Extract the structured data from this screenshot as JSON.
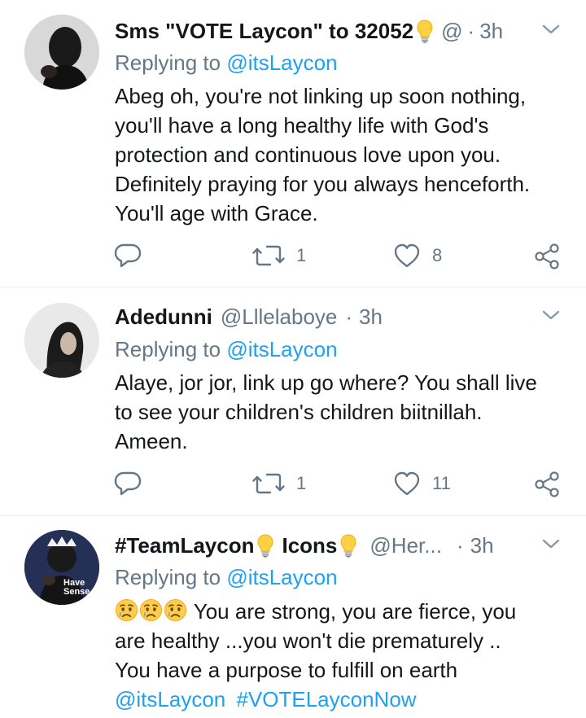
{
  "tweets": [
    {
      "name": "Sms \"VOTE Laycon\" to 32052",
      "handle": "@",
      "sep": "·",
      "time": "3h",
      "reply_prefix": "Replying to ",
      "reply_handle": "@itsLaycon",
      "lines": [
        "Abeg oh, you're not linking up soon nothing,",
        "you'll have a long healthy life with God's",
        "protection and continuous love upon you.",
        "Definitely praying for you always henceforth.",
        "You'll age with Grace."
      ],
      "retweets": "1",
      "likes": "8"
    },
    {
      "name": "Adedunni",
      "handle": "@Lllelaboye",
      "sep": "·",
      "time": "3h",
      "reply_prefix": "Replying to ",
      "reply_handle": "@itsLaycon",
      "lines": [
        "Alaye, jor jor, link up go where? You shall live",
        "to see your children's children biitnillah.",
        "Ameen."
      ],
      "retweets": "1",
      "likes": "11"
    },
    {
      "name_part1": "#TeamLaycon",
      "name_part2": "Icons",
      "handle": "@Her...",
      "sep": "·",
      "time": "3h",
      "reply_prefix": "Replying to ",
      "reply_handle": "@itsLaycon",
      "avatar_text": "Have Sense",
      "line1_text": " You are strong, you are fierce, you",
      "line2": "are healthy ...you won't die prematurely ..",
      "line3": "You have a purpose to fulfill on earth",
      "mention": "@itsLaycon",
      "hashtag": "#VOTELayconNow"
    }
  ],
  "colors": {
    "link": "#1da1f2",
    "muted": "#657786",
    "text": "#14171a",
    "divider": "#e6ecf0"
  },
  "icons": [
    "reply-icon",
    "retweet-icon",
    "like-icon",
    "share-icon",
    "chevron-down-icon",
    "lightbulb-icon",
    "crying-face-icon"
  ]
}
